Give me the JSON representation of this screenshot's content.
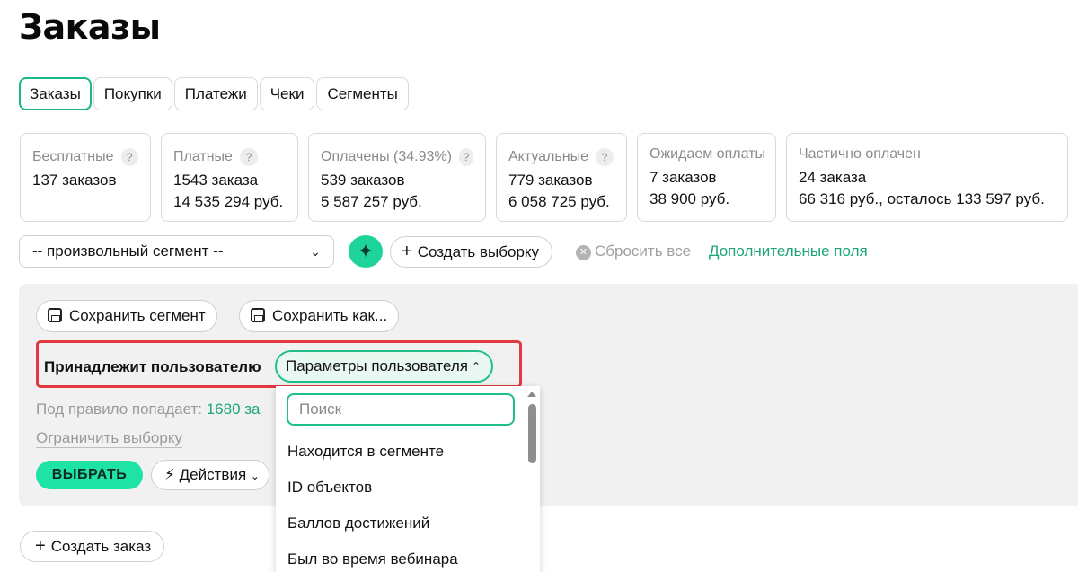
{
  "page": {
    "title": "Заказы"
  },
  "tabs": [
    "Заказы",
    "Покупки",
    "Платежи",
    "Чеки",
    "Сегменты"
  ],
  "stats": [
    {
      "label": "Бесплатные",
      "help": "?",
      "line1": "137 заказов",
      "line2": ""
    },
    {
      "label": "Платные",
      "help": "?",
      "line1": "1543 заказа",
      "line2": "14 535 294 руб."
    },
    {
      "label": "Оплачены (34.93%)",
      "help": "?",
      "line1": "539 заказов",
      "line2": "5 587 257 руб."
    },
    {
      "label": "Актуальные",
      "help": "?",
      "line1": "779 заказов",
      "line2": "6 058 725 руб."
    },
    {
      "label": "Ожидаем оплаты",
      "help": "",
      "line1": "7 заказов",
      "line2": "38 900 руб."
    },
    {
      "label": "Частично оплачен",
      "help": "",
      "line1": "24 заказа",
      "line2": "66 316 руб., осталось 133 597 руб."
    }
  ],
  "filter": {
    "segment_select": "-- произвольный сегмент --",
    "ai_icon": "sparkle-icon",
    "create_selection": "Создать выборку",
    "reset_all": "Сбросить все",
    "extra_fields": "Дополнительные поля"
  },
  "segment_panel": {
    "save_segment": "Сохранить сегмент",
    "save_as": "Сохранить как...",
    "rule_label": "Принадлежит пользователю",
    "param_button": "Параметры пользователя",
    "hits_prefix": "Под правило попадает:",
    "hits_count": "1680 за",
    "limit_selection": "Ограничить выборку",
    "choose_button": "ВЫБРАТЬ",
    "actions_button": "Действия"
  },
  "dropdown": {
    "search_placeholder": "Поиск",
    "items": [
      "Находится в сегменте",
      "ID объектов",
      "Баллов достижений",
      "Был во время вебинара"
    ]
  },
  "create_order": "Создать заказ",
  "colors": {
    "accent": "#1fbf8d",
    "accent_button": "#1fe3a5",
    "highlight_border": "#e0393e",
    "link": "#1aa579"
  }
}
